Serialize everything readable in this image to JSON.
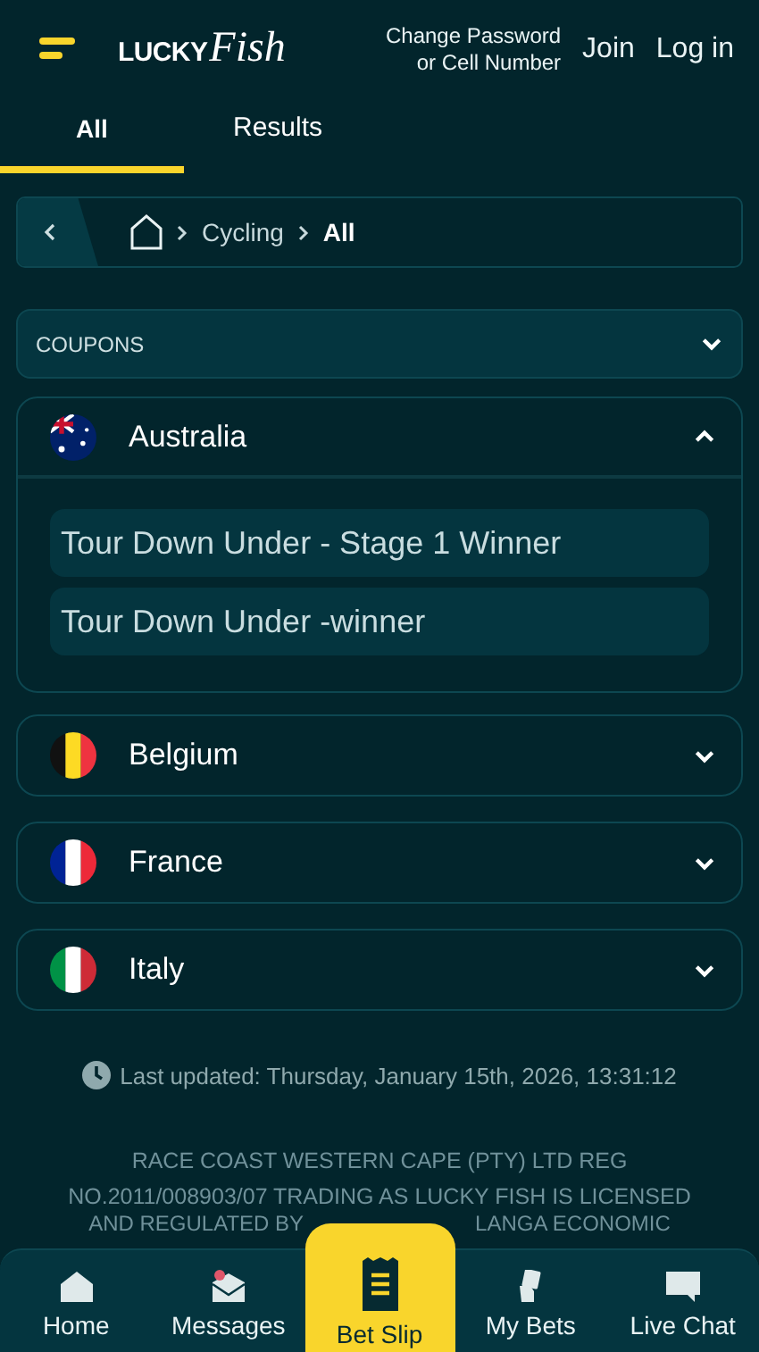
{
  "header": {
    "logo": {
      "word_1": "LUCKY",
      "word_2": "Fish"
    },
    "account_link": "Change Password\nor Cell Number",
    "join": "Join",
    "login": "Log in"
  },
  "tabs": [
    {
      "label": "All",
      "selected": true
    },
    {
      "label": "Results",
      "selected": false
    }
  ],
  "breadcrumb": {
    "items": [
      "Cycling",
      "All"
    ]
  },
  "coupons": {
    "label": "COUPONS",
    "expanded": false
  },
  "countries": [
    {
      "name": "Australia",
      "kind": "au",
      "expanded": true,
      "markets": [
        "Tour Down Under - Stage 1 Winner",
        "Tour Down Under -winner"
      ]
    },
    {
      "name": "Belgium",
      "kind": "be",
      "expanded": false
    },
    {
      "name": "France",
      "kind": "fr",
      "expanded": false
    },
    {
      "name": "Italy",
      "kind": "it",
      "expanded": false
    }
  ],
  "last_updated": "Last updated: Thursday, January 15th, 2026, 13:31:12",
  "legal": {
    "lines": [
      "RACE COAST WESTERN CAPE (PTY) LTD REG",
      "NO.2011/008903/07 TRADING AS LUCKY FISH IS LICENSED"
    ],
    "line_3_left": "AND REGULATED BY",
    "line_3_right": "LANGA ECONOMIC"
  },
  "bottom_nav": [
    {
      "label": "Home",
      "kind": "home",
      "selected": false
    },
    {
      "label": "Messages",
      "kind": "messages",
      "selected": false,
      "unread": true
    },
    {
      "label": "Bet Slip",
      "kind": "betslip",
      "selected": true
    },
    {
      "label": "My Bets",
      "kind": "mybets",
      "selected": false
    },
    {
      "label": "Live Chat",
      "kind": "chat",
      "selected": false
    }
  ]
}
